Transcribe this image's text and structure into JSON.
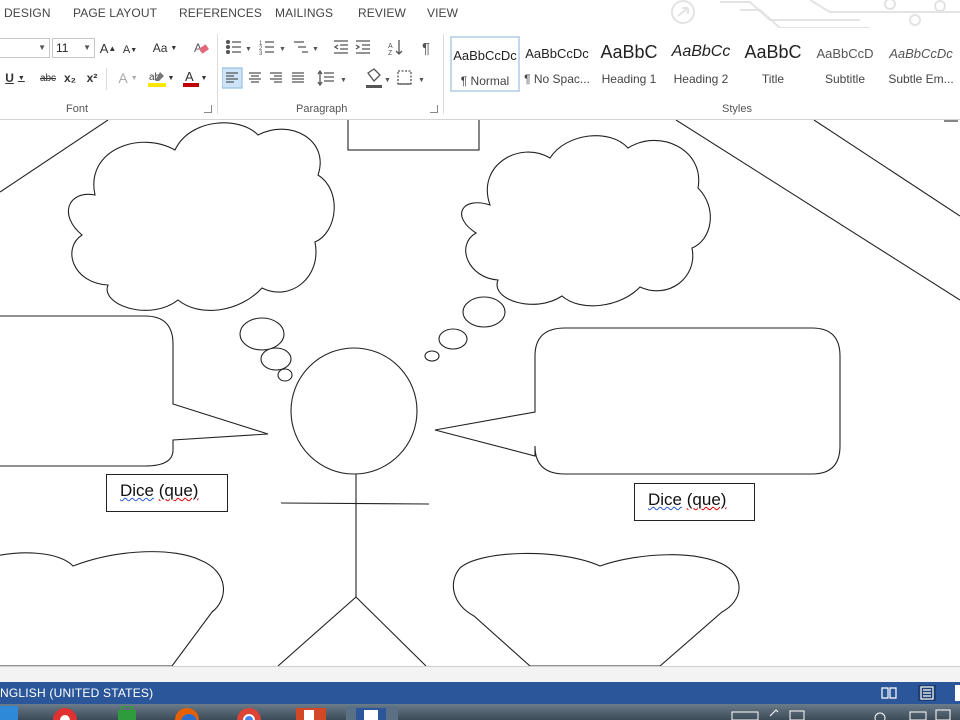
{
  "ribbon": {
    "tabs": [
      "DESIGN",
      "PAGE LAYOUT",
      "REFERENCES",
      "MAILINGS",
      "REVIEW",
      "VIEW"
    ],
    "font": {
      "group_label": "Font",
      "size_value": "11",
      "grow_label": "A",
      "shrink_label": "A",
      "case_label": "Aa",
      "underline_label": "U",
      "strike_label": "abc",
      "sub_label": "x₂",
      "sup_label": "x²",
      "effects_label": "A",
      "color_label": "A"
    },
    "paragraph": {
      "group_label": "Paragraph"
    },
    "styles": {
      "group_label": "Styles",
      "items": [
        {
          "preview": "AaBbCcDc",
          "name": "¶ Normal"
        },
        {
          "preview": "AaBbCcDc",
          "name": "¶ No Spac..."
        },
        {
          "preview": "AaBbC",
          "name": "Heading 1"
        },
        {
          "preview": "AaBbCc",
          "name": "Heading 2"
        },
        {
          "preview": "AaBbC",
          "name": "Title"
        },
        {
          "preview": "AaBbCcD",
          "name": "Subtitle"
        },
        {
          "preview": "AaBbCcDc",
          "name": "Subtle Em..."
        }
      ]
    }
  },
  "document": {
    "left_caption": {
      "word1": "Dice",
      "word2": "(que)"
    },
    "right_caption": {
      "word1": "Dice",
      "word2": "(que)"
    }
  },
  "status_bar": {
    "language": "NGLISH (UNITED STATES)"
  },
  "colors": {
    "status_bar": "#2b579a",
    "highlight": "#ffe600",
    "font_color": "#c00000",
    "spell_error": "#d00000",
    "grammar_error": "#2a5bd7"
  }
}
